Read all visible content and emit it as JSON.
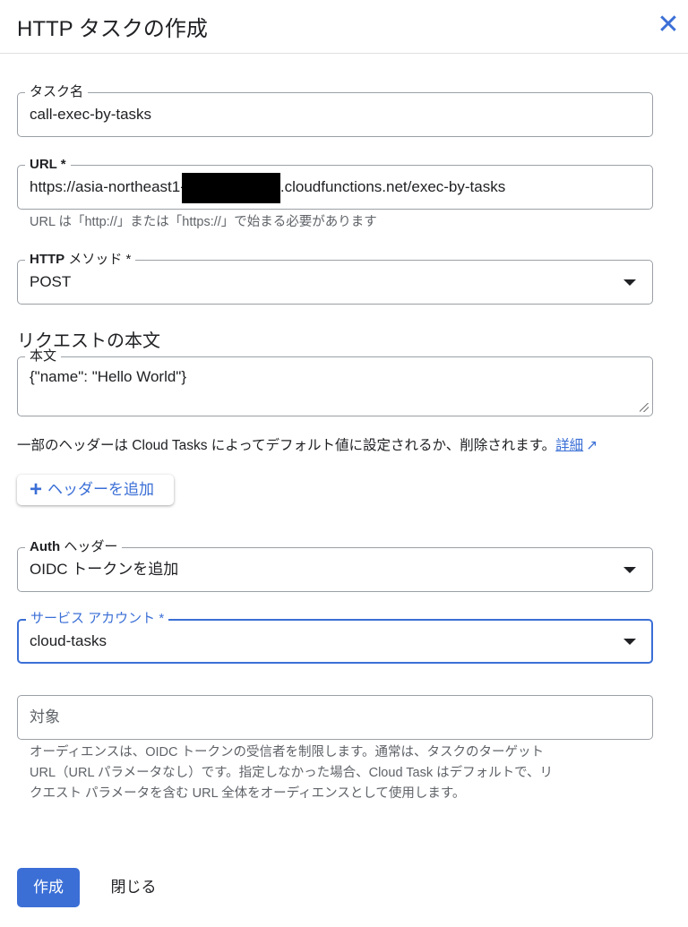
{
  "header": {
    "title": "HTTP タスクの作成",
    "close_icon": "close-icon"
  },
  "task_name": {
    "label": "タスク名",
    "value": "call-exec-by-tasks"
  },
  "url": {
    "label": "URL *",
    "value_prefix": "https://asia-northeast1-",
    "value_suffix": ".cloudfunctions.net/exec-by-tasks",
    "help": "URL は「http://」または「https://」で始まる必要があります"
  },
  "http_method": {
    "label_bold": "HTTP",
    "label": " メソッド *",
    "value": "POST"
  },
  "request_body": {
    "heading": "リクエストの本文",
    "label": "本文",
    "value": "{\"name\": \"Hello World\"}"
  },
  "headers_note": {
    "text": "一部のヘッダーは Cloud Tasks によってデフォルト値に設定されるか、削除されます。",
    "link": "詳細"
  },
  "add_header": {
    "label": "ヘッダーを追加"
  },
  "auth_header": {
    "label_bold": "Auth",
    "label": " ヘッダー",
    "value": "OIDC トークンを追加"
  },
  "service_account": {
    "label": "サービス アカウント *",
    "value": "cloud-tasks"
  },
  "audience": {
    "placeholder": "対象",
    "help": [
      "オーディエンスは、OIDC トークンの受信者を制限します。通常は、タスクのターゲット",
      "URL（URL パラメータなし）です。指定しなかった場合、Cloud Task はデフォルトで、リ",
      "クエスト パラメータを含む URL 全体をオーディエンスとして使用します。"
    ]
  },
  "footer": {
    "create": "作成",
    "close": "閉じる"
  },
  "colors": {
    "accent": "#3b6fd6"
  }
}
